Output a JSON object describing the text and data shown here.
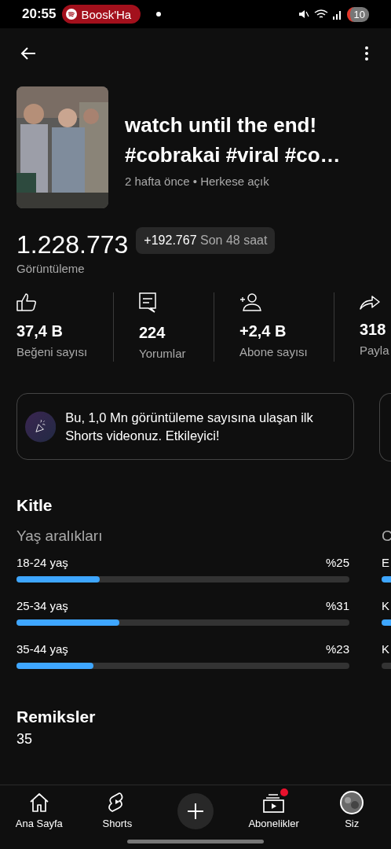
{
  "status_bar": {
    "time": "20:55",
    "media_chip": "Boosk'Ha",
    "battery": "10"
  },
  "video": {
    "title": "watch until the end! #cobrakai #viral #co…",
    "meta": "2 hafta önce • Herkese açık"
  },
  "views": {
    "count": "1.228.773",
    "label": "Görüntüleme",
    "delta": "+192.767",
    "delta_period": "Son 48 saat"
  },
  "stats": [
    {
      "kind": "like",
      "value": "37,4 B",
      "label": "Beğeni sayısı"
    },
    {
      "kind": "comment",
      "value": "224",
      "label": "Yorumlar"
    },
    {
      "kind": "subscriber",
      "value": "+2,4 B",
      "label": "Abone sayısı"
    },
    {
      "kind": "share",
      "value": "318",
      "label": "Payla"
    }
  ],
  "milestone": {
    "text": "Bu, 1,0 Mn görüntüleme sayısına ulaşan ilk Shorts videonuz. Etkileyici!"
  },
  "audience": {
    "title": "Kitle",
    "age_title": "Yaş aralıkları",
    "age_groups": [
      {
        "label": "18-24 yaş",
        "percent": "%25",
        "level": 0.25
      },
      {
        "label": "25-34 yaş",
        "percent": "%31",
        "level": 0.31
      },
      {
        "label": "35-44 yaş",
        "percent": "%23",
        "level": 0.23
      }
    ],
    "next_column": {
      "title": "C",
      "rows": [
        {
          "label": "E",
          "color": "#3ea6ff"
        },
        {
          "label": "K",
          "color": "#3ea6ff"
        },
        {
          "label": "K",
          "color": "#333333"
        }
      ]
    }
  },
  "remixes": {
    "title": "Remiksler",
    "count": "35"
  },
  "nav": [
    {
      "kind": "home",
      "label": "Ana Sayfa",
      "dot": false
    },
    {
      "kind": "shorts",
      "label": "Shorts",
      "dot": false
    },
    {
      "kind": "create",
      "dot": false
    },
    {
      "kind": "subscriptions",
      "label": "Abonelikler",
      "dot": true
    },
    {
      "kind": "you",
      "label": "Siz",
      "dot": false
    }
  ]
}
